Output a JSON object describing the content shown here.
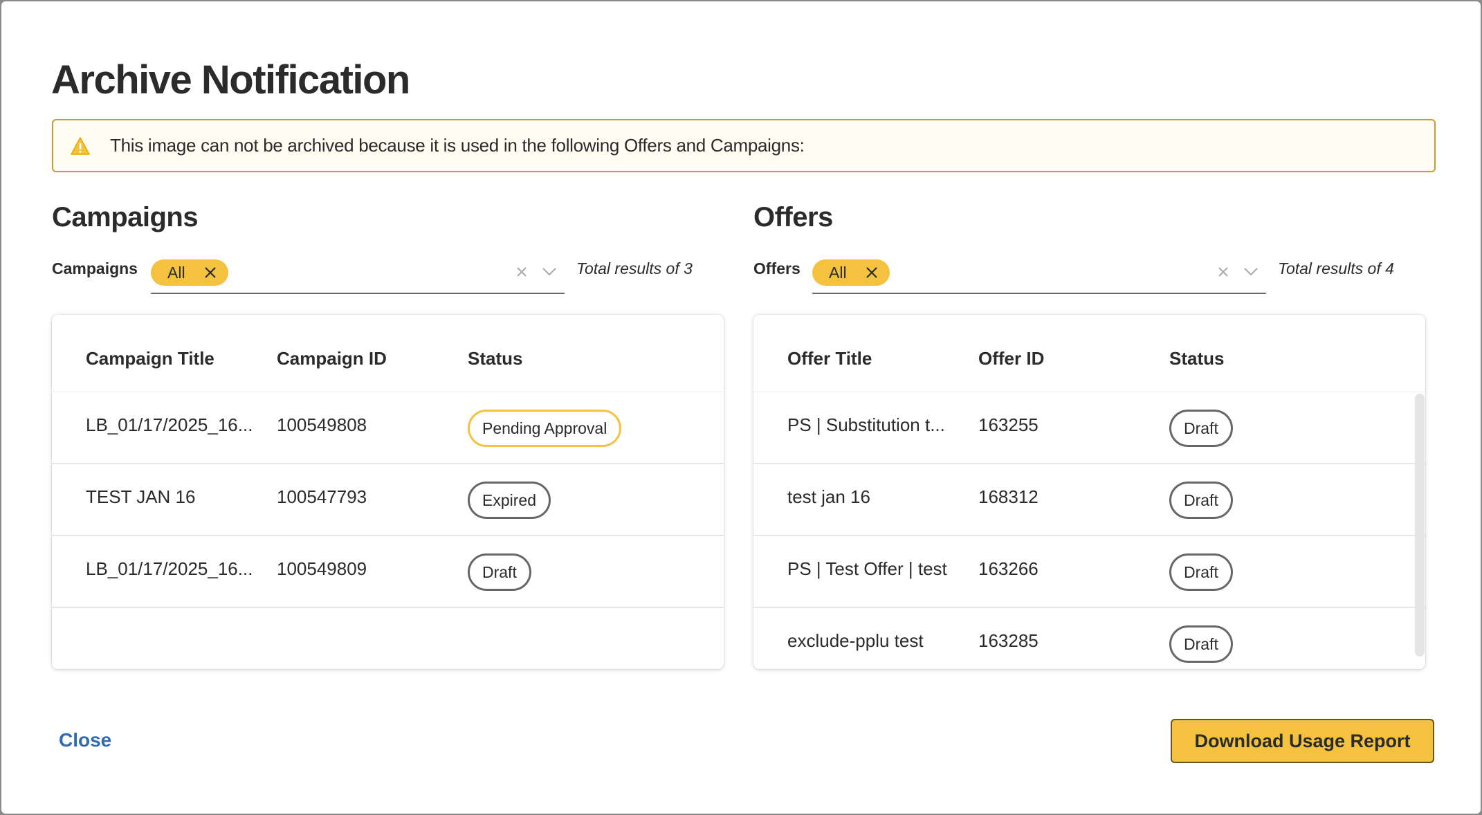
{
  "modal": {
    "title": "Archive Notification",
    "alert_text": "This image can not be archived because it is used in the following Offers and Campaigns:",
    "alert_icon": "warning-icon"
  },
  "campaigns": {
    "section_title": "Campaigns",
    "filter_label": "Campaigns",
    "chip_label": "All",
    "total_text": "Total results of 3",
    "columns": [
      "Campaign Title",
      "Campaign ID",
      "Status"
    ],
    "rows": [
      {
        "title": "LB_01/17/2025_16...",
        "id": "100549808",
        "status": "Pending Approval"
      },
      {
        "title": "TEST JAN 16",
        "id": "100547793",
        "status": "Expired"
      },
      {
        "title": "LB_01/17/2025_16...",
        "id": "100549809",
        "status": "Draft"
      }
    ]
  },
  "offers": {
    "section_title": "Offers",
    "filter_label": "Offers",
    "chip_label": "All",
    "total_text": "Total results of 4",
    "columns": [
      "Offer Title",
      "Offer ID",
      "Status"
    ],
    "rows": [
      {
        "title": "PS | Substitution t...",
        "id": "163255",
        "status": "Draft"
      },
      {
        "title": "test jan 16",
        "id": "168312",
        "status": "Draft"
      },
      {
        "title": "PS | Test Offer | test",
        "id": "163266",
        "status": "Draft"
      },
      {
        "title": "exclude-pplu test",
        "id": "163285",
        "status": "Draft"
      }
    ]
  },
  "footer": {
    "close_label": "Close",
    "download_label": "Download Usage Report"
  },
  "colors": {
    "accent": "#f4c23f",
    "alert_border": "#c99a2e",
    "link": "#2f6cad"
  }
}
